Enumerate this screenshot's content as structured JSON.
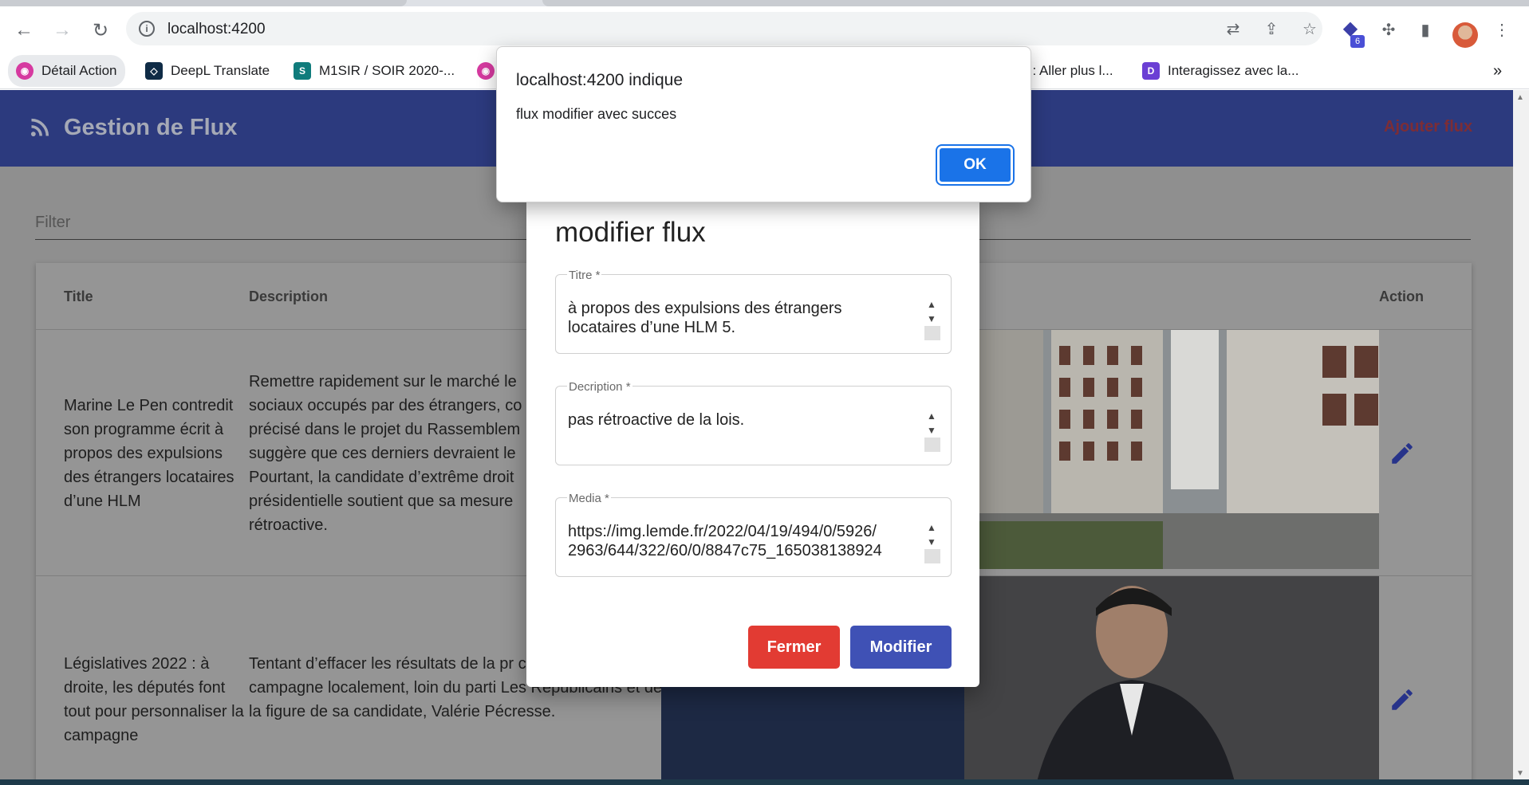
{
  "browser": {
    "url": "localhost:4200",
    "extension_badge": "6",
    "bookmarks": [
      {
        "label": "Détail Action"
      },
      {
        "label": "DeepL Translate"
      },
      {
        "label": "M1SIR / SOIR 2020-..."
      },
      {
        "label": "l : Aller plus l..."
      },
      {
        "label": "Interagissez avec la..."
      }
    ],
    "bookmarks_overflow": "»"
  },
  "app": {
    "title": "Gestion de Flux",
    "add_label": "Ajouter flux",
    "filter_label": "Filter"
  },
  "table": {
    "headers": {
      "title": "Title",
      "description": "Description",
      "action": "Action"
    },
    "rows": [
      {
        "title": "Marine Le Pen contredit son programme écrit à propos des expulsions des étrangers locataires d’une HLM",
        "description": "Remettre rapidement sur le marché le sociaux occupés par des étrangers, co précisé dans le projet du Rassemblem suggère que ces derniers devraient le Pourtant, la candidate d’extrême droit présidentielle soutient que sa mesure rétroactive."
      },
      {
        "title": "Législatives 2022 : à droite, les députés font tout pour personnaliser la campagne",
        "description": "Tentant d’effacer les résultats de la pr candidats mènent campagne localement, loin du parti Les Républicains et de la figure de sa candidate, Valérie Pécresse."
      }
    ]
  },
  "dialog": {
    "title": "modifier flux",
    "fields": {
      "titre": {
        "label": "Titre *",
        "value": "à propos des expulsions des étrangers\nlocataires d’une HLM 5."
      },
      "description": {
        "label": "Decription *",
        "value": "pas rétroactive de la lois."
      },
      "media": {
        "label": "Media *",
        "value": "https://img.lemde.fr/2022/04/19/494/0/5926/\n2963/644/322/60/0/8847c75_165038138924"
      }
    },
    "close_label": "Fermer",
    "modify_label": "Modifier"
  },
  "alert": {
    "title": "localhost:4200 indique",
    "message": "flux modifier avec succes",
    "ok_label": "OK"
  },
  "colors": {
    "header": "#2c3a7e",
    "primary": "#3f51b5",
    "danger": "#e23b33",
    "chrome_blue": "#1a73e8"
  }
}
